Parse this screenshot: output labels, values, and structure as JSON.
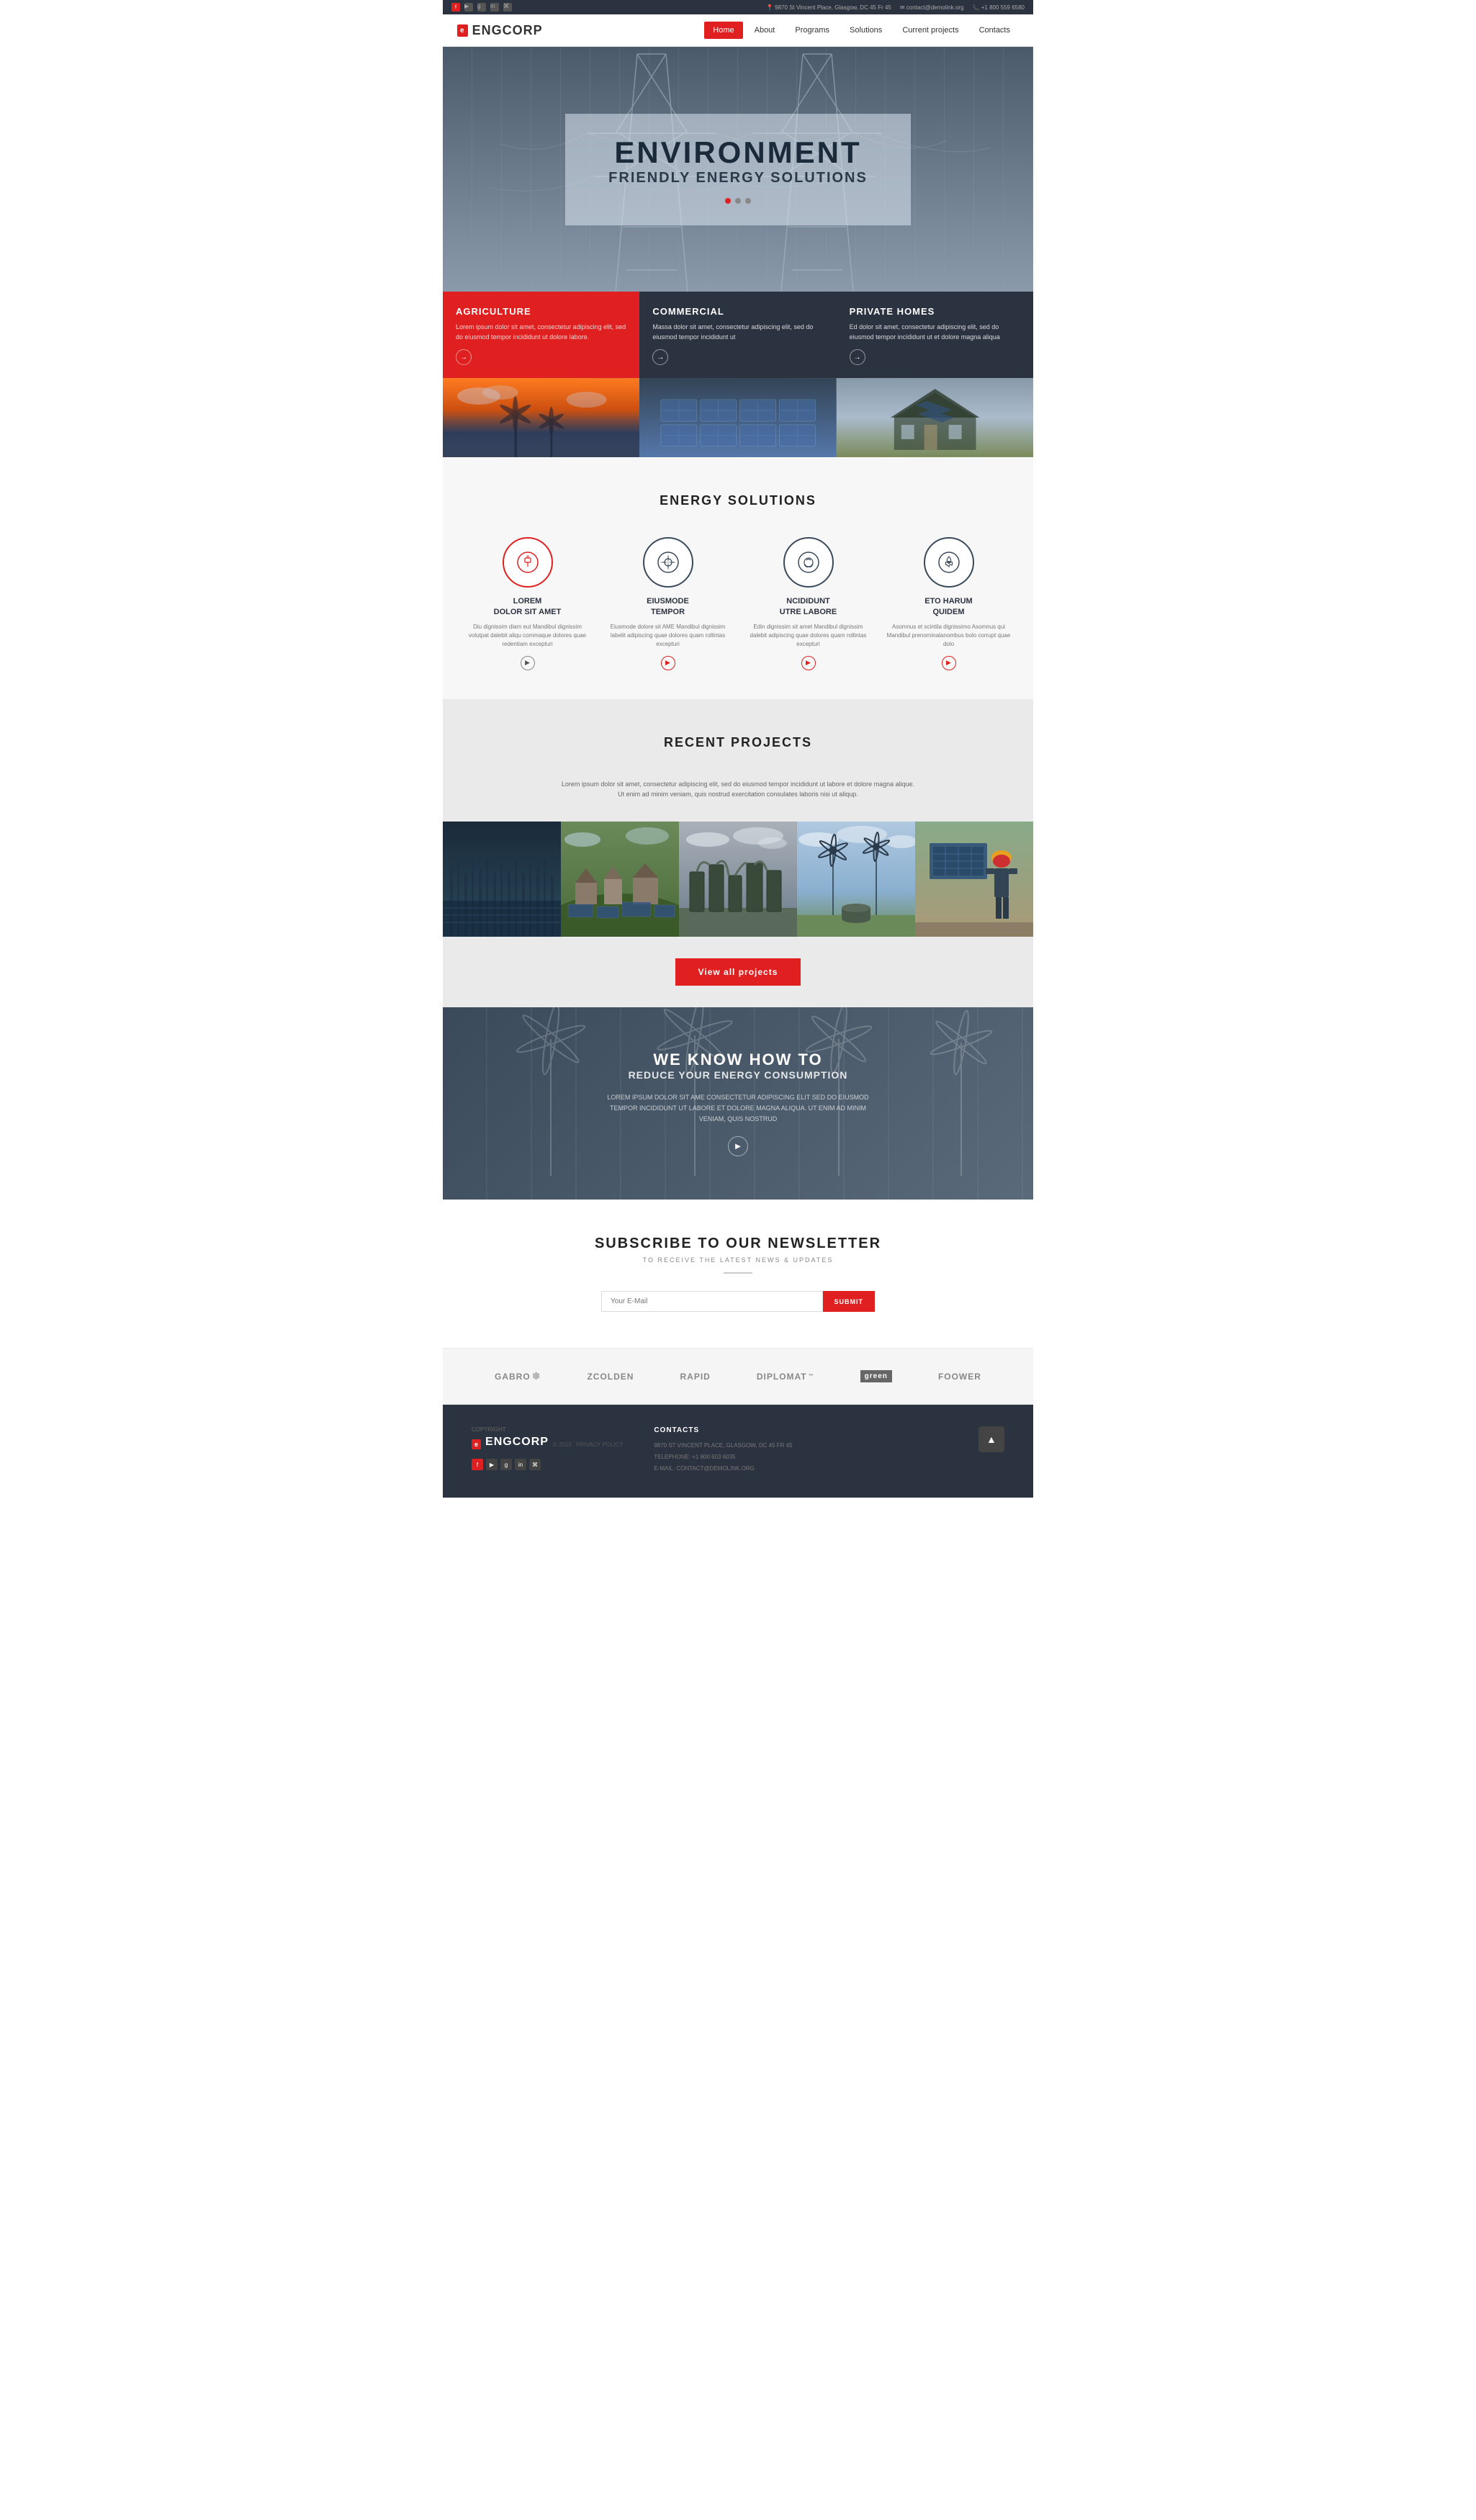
{
  "topbar": {
    "address": "9870 St Vincent Place, Glasgow, DC 45 Fr 45",
    "email": "contact@demolink.org",
    "phone": "+1 800 559 6580",
    "social_icons": [
      "f",
      "t",
      "g",
      "r",
      "rss"
    ]
  },
  "header": {
    "logo_icon": "e",
    "logo_text": "ENGCORP",
    "nav": [
      {
        "label": "Home",
        "active": true
      },
      {
        "label": "About",
        "active": false
      },
      {
        "label": "Programs",
        "active": false
      },
      {
        "label": "Solutions",
        "active": false
      },
      {
        "label": "Current projects",
        "active": false
      },
      {
        "label": "Contacts",
        "active": false
      }
    ]
  },
  "hero": {
    "title_main": "ENVIRONMENT",
    "title_sub": "FRIENDLY ENERGY SOLUTIONS"
  },
  "services": [
    {
      "title": "AGRICULTURE",
      "text": "Lorem ipsum dolor sit amet, consectetur adipiscing elit, sed do eiusmod tempor incididunt ut dolore labore.",
      "theme": "red"
    },
    {
      "title": "COMMERCIAL",
      "text": "Massa dolor sit amet, consectetur adipiscing elit, sed do eiusmod tempor incididunt ut",
      "theme": "dark"
    },
    {
      "title": "PRIVATE HOMES",
      "text": "Ed dolor sit amet, consectetur adipiscing elit, sed do eiusmod tempor incididunt ut et dolore magna aliqua",
      "theme": "dark"
    }
  ],
  "energy_solutions": {
    "section_title": "ENERGY SOLUTIONS",
    "items": [
      {
        "icon": "⚙",
        "icon_type": "red",
        "title": "LOREM\nDOLOR SIT AMET",
        "text": "Diu dignissim diam eut Mandibul dignissim volutpat dalebit aliqu commaque dolores quae redentiam excepturi"
      },
      {
        "icon": "✿",
        "icon_type": "dark",
        "title": "EIUSMODE\nTEMPOR",
        "text": "Eiusmode dolore sit AME Mandibul dignissim labelit adipiscing quae dolores quam rollintas excepturi"
      },
      {
        "icon": "◎",
        "icon_type": "dark",
        "title": "NCIDIDUNT\nUTRE LABORE",
        "text": "Edin dignissim sit amet Mandibul dignissim dalebit adipiscing quae dolores quam rollintas excepturi"
      },
      {
        "icon": "💡",
        "icon_type": "dark",
        "title": "ETO HARUM\nQUIDEM",
        "text": "Asomnus et scintila dignissimo Asomnus qui Mandibul prenominalanombus bolo corrupt quae dolo"
      }
    ]
  },
  "recent_projects": {
    "section_title": "RECENT PROJECTS",
    "description": "Lorem ipsum dolor sit amet, consectetur adipiscing elit, sed do eiusmod tempor incididunt ut labore et dolore magna alique. Ut enim ad minim veniam, quis nostrud exercitation consulates laboris nisi ut aliqup.",
    "view_all_btn": "View all projects",
    "projects": [
      {
        "theme": "water"
      },
      {
        "theme": "village"
      },
      {
        "theme": "industrial"
      },
      {
        "theme": "wind"
      },
      {
        "theme": "worker"
      }
    ]
  },
  "cta": {
    "title": "WE KNOW HOW TO",
    "subtitle": "REDUCE YOUR ENERGY CONSUMPTION",
    "text": "LOREM IPSUM DOLOR SIT AME CONSECTETUR ADIPISCING ELIT SED DO EIUSMOD TEMPOR INCIDIDUNT UT LABORE ET DOLORE MAGNA ALIQUA. UT ENIM AD MINIM VENIAM, QUIS NOSTRUD"
  },
  "newsletter": {
    "title": "SUBSCRIBE TO OUR NEWSLETTER",
    "subtitle": "TO RECEIVE THE LATEST NEWS & UPDATES",
    "input_placeholder": "Your E-Mail",
    "submit_btn": "SUBMIT"
  },
  "partners": [
    {
      "name": "GABRO",
      "icon": "❄"
    },
    {
      "name": "ZCOLDEN",
      "icon": ""
    },
    {
      "name": "RAPID",
      "icon": ""
    },
    {
      "name": "DIPLOMAT",
      "icon": ""
    },
    {
      "name": "green",
      "boxed": true
    },
    {
      "name": "FOOWER",
      "icon": ""
    }
  ],
  "footer": {
    "copyright_label": "COPYRIGHT",
    "logo_text": "ENGCORP",
    "year": "© 2015",
    "privacy": "PRIVACY POLICY",
    "contacts_label": "CONTACTS",
    "address": "9870 ST VINCENT PLACE,\nGLASGOW, DC 45 FR 45",
    "telephone_label": "TELEPHONE:",
    "telephone": "+1 800 603 6035",
    "email_label": "E-MAIL:",
    "email": "CONTACT@DEMOLINK.ORG",
    "scroll_top": "▲"
  }
}
